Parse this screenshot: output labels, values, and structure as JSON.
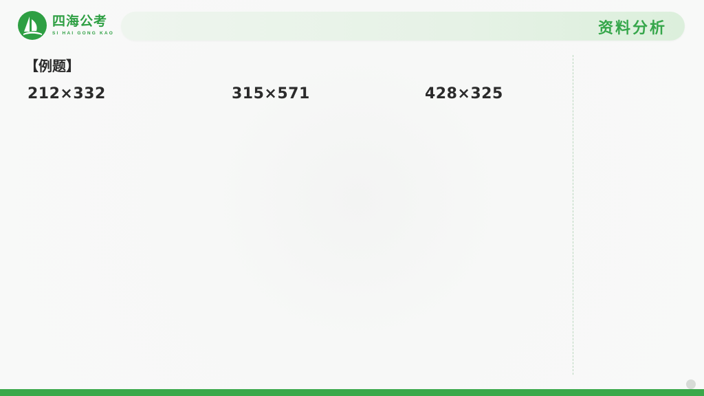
{
  "header": {
    "logo_cn": "四海公考",
    "logo_en": "SI HAI GONG KAO",
    "section_title": "资料分析"
  },
  "content": {
    "label": "【例题】",
    "expressions": [
      "212×332",
      "315×571",
      "428×325"
    ]
  },
  "colors": {
    "brand_green": "#2e9f43",
    "title_green": "#35a64a",
    "bottom_bar": "#3aa84a"
  },
  "icons": {
    "logo": "sailboat-leaf-icon"
  }
}
